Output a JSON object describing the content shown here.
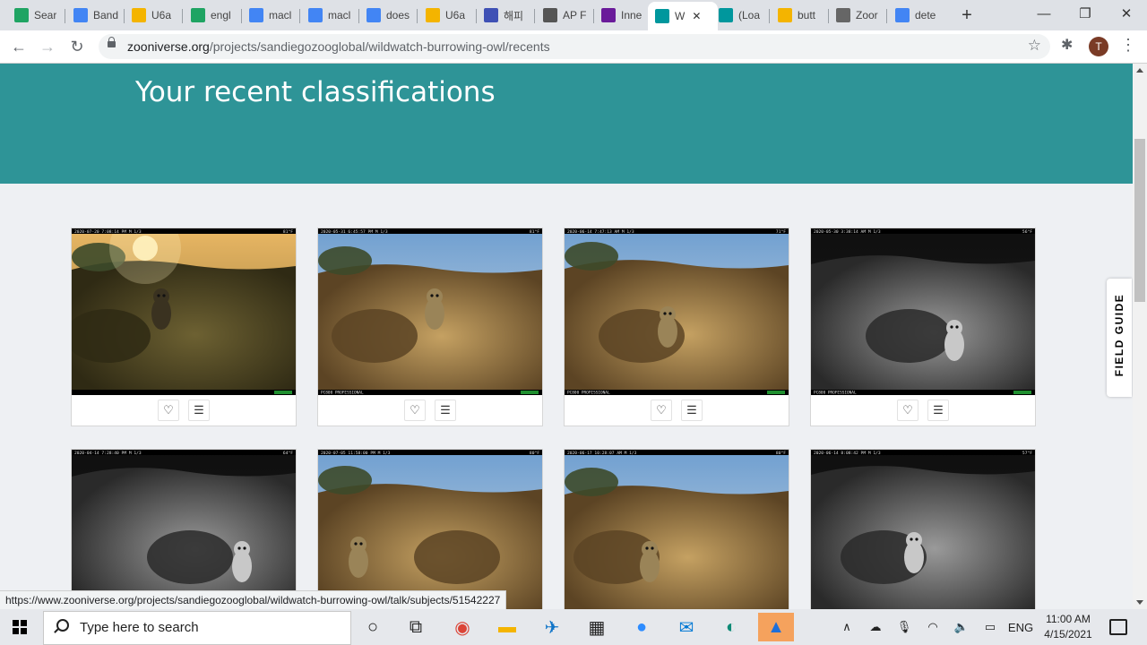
{
  "browser": {
    "tabs": [
      {
        "title": "Sear",
        "icon": "google-drive-icon",
        "color": "#1fa463"
      },
      {
        "title": "Band",
        "icon": "google-docs-icon",
        "color": "#4285f4"
      },
      {
        "title": "U6a",
        "icon": "google-slides-icon",
        "color": "#f4b400"
      },
      {
        "title": "engl",
        "icon": "google-drive-icon",
        "color": "#1fa463"
      },
      {
        "title": "macl",
        "icon": "google-docs-icon",
        "color": "#4285f4"
      },
      {
        "title": "macl",
        "icon": "google-docs-icon",
        "color": "#4285f4"
      },
      {
        "title": "does",
        "icon": "google-icon",
        "color": "#4285f4"
      },
      {
        "title": "U6a",
        "icon": "google-slides-icon",
        "color": "#f4b400"
      },
      {
        "title": "해피",
        "icon": "u-app-icon",
        "color": "#3f51b5"
      },
      {
        "title": "AP F",
        "icon": "shield-icon",
        "color": "#555555"
      },
      {
        "title": "Inne",
        "icon": "network-icon",
        "color": "#6a1b9a"
      },
      {
        "title": "W",
        "icon": "zooniverse-icon",
        "color": "#00979d"
      },
      {
        "title": "(Loa",
        "icon": "zooniverse-icon",
        "color": "#00979d"
      },
      {
        "title": "butt",
        "icon": "image-icon",
        "color": "#f4b400"
      },
      {
        "title": "Zoor",
        "icon": "loading-icon",
        "color": "#666666"
      },
      {
        "title": "dete",
        "icon": "google-icon",
        "color": "#4285f4"
      }
    ],
    "active_tab_index": 11,
    "close_glyph": "✕",
    "new_tab_glyph": "+",
    "window_controls": {
      "minimize": "—",
      "restore": "❐",
      "close": "✕"
    },
    "nav": {
      "back": "←",
      "forward": "→",
      "reload": "↻"
    },
    "url_host": "zooniverse.org",
    "url_path": "/projects/sandiegozooglobal/wildwatch-burrowing-owl/recents",
    "bookmark_glyph": "☆",
    "extensions_glyph": "✱",
    "profile_initial": "T",
    "menu_glyph": "⋮"
  },
  "page": {
    "hero_title": "Your recent classifications",
    "field_guide_label": "FIELD GUIDE",
    "favorite_glyph": "♡",
    "collect_glyph": "☰",
    "cards": [
      {
        "timestamp": "2020-07-20  7:08:14 PM  M 1/3",
        "temp": "81°F",
        "brand": "",
        "palette": "sunset",
        "variant": 0
      },
      {
        "timestamp": "2020-05-31  6:45:57 PM  M 1/3",
        "temp": "81°F",
        "brand": "PC800 PROFESSIONAL",
        "palette": "day",
        "variant": 1
      },
      {
        "timestamp": "2020-06-14  7:47:13 AM  M 1/3",
        "temp": "71°F",
        "brand": "PC800 PROFESSIONAL",
        "palette": "day",
        "variant": 2
      },
      {
        "timestamp": "2020-05-30  3:38:14 AM  M 1/3",
        "temp": "56°F",
        "brand": "PC800 PROFESSIONAL",
        "palette": "night",
        "variant": 3
      },
      {
        "timestamp": "2020-04-14  7:28:40 PM  M 1/3",
        "temp": "64°F",
        "brand": "",
        "palette": "night",
        "variant": 4
      },
      {
        "timestamp": "2020-07-05  11:58:00 PM  M 1/3",
        "temp": "80°F",
        "brand": "",
        "palette": "day",
        "variant": 5
      },
      {
        "timestamp": "2020-06-17  10:28:07 AM  M 1/3",
        "temp": "80°F",
        "brand": "",
        "palette": "day",
        "variant": 6
      },
      {
        "timestamp": "2020-06-14  8:08:42 PM  M 1/3",
        "temp": "57°F",
        "brand": "",
        "palette": "night",
        "variant": 7
      }
    ]
  },
  "status_bar_url": "https://www.zooniverse.org/projects/sandiegozooglobal/wildwatch-burrowing-owl/talk/subjects/51542227",
  "taskbar": {
    "search_placeholder": "Type here to search",
    "apps": [
      {
        "name": "cortana-icon",
        "glyph": "○",
        "color": "#222222"
      },
      {
        "name": "task-view-icon",
        "glyph": "⧉",
        "color": "#222222"
      },
      {
        "name": "chrome-icon",
        "glyph": "◉",
        "color": "#db4437"
      },
      {
        "name": "file-explorer-icon",
        "glyph": "▬",
        "color": "#f4b400"
      },
      {
        "name": "edge-beta-icon",
        "glyph": "✈",
        "color": "#0f74c8"
      },
      {
        "name": "store-icon",
        "glyph": "▦",
        "color": "#222222"
      },
      {
        "name": "zoom-icon",
        "glyph": "●",
        "color": "#2d8cff"
      },
      {
        "name": "mail-icon",
        "glyph": "✉",
        "color": "#0078d4"
      },
      {
        "name": "edge-icon",
        "glyph": "◐",
        "color": "#0e8a76"
      },
      {
        "name": "app-active-icon",
        "glyph": "▲",
        "color": "#1e6fd9"
      }
    ],
    "active_app_index": 9,
    "tray": {
      "chevron": "∧",
      "language": "ENG"
    },
    "time": "11:00 AM",
    "date": "4/15/2021"
  }
}
